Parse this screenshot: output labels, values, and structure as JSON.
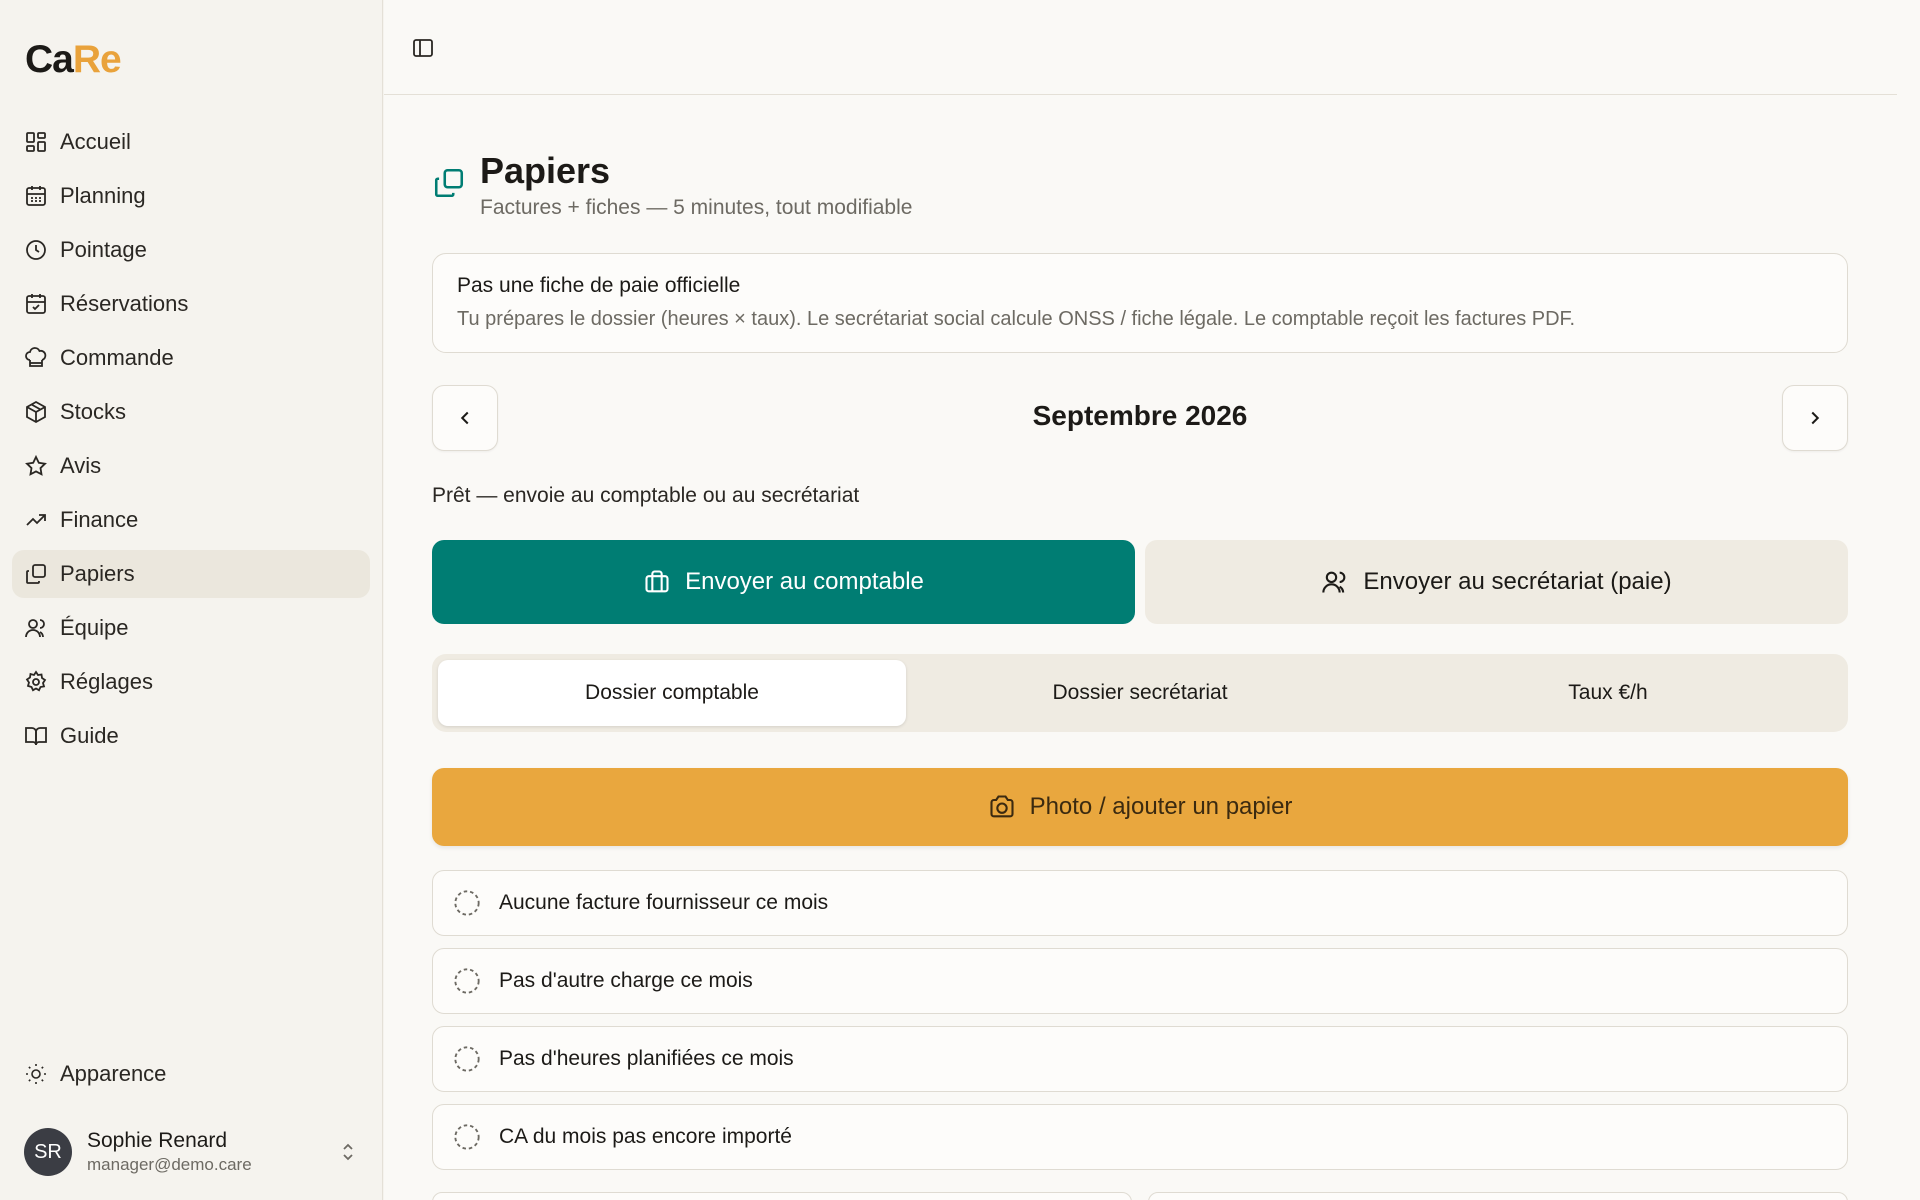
{
  "logo": {
    "part1": "Ca",
    "part2": "Re"
  },
  "colors": {
    "primary": "#007d73",
    "accent": "#e9a73e",
    "active_nav": "#ebe7dd"
  },
  "sidebar": {
    "items": [
      {
        "label": "Accueil",
        "icon": "dashboard-icon"
      },
      {
        "label": "Planning",
        "icon": "calendar-icon"
      },
      {
        "label": "Pointage",
        "icon": "clock-icon"
      },
      {
        "label": "Réservations",
        "icon": "calendar-check-icon"
      },
      {
        "label": "Commande",
        "icon": "chef-hat-icon"
      },
      {
        "label": "Stocks",
        "icon": "package-icon"
      },
      {
        "label": "Avis",
        "icon": "star-icon"
      },
      {
        "label": "Finance",
        "icon": "trending-up-icon"
      },
      {
        "label": "Papiers",
        "icon": "copy-icon",
        "active": true
      },
      {
        "label": "Équipe",
        "icon": "users-icon"
      },
      {
        "label": "Réglages",
        "icon": "gear-icon"
      },
      {
        "label": "Guide",
        "icon": "book-icon"
      }
    ],
    "appearance": "Apparence",
    "user": {
      "initials": "SR",
      "name": "Sophie Renard",
      "email": "manager@demo.care"
    }
  },
  "page": {
    "title": "Papiers",
    "subtitle": "Factures + fiches — 5 minutes, tout modifiable"
  },
  "notice": {
    "title": "Pas une fiche de paie officielle",
    "text": "Tu prépares le dossier (heures × taux). Le secrétariat social calcule ONSS / fiche légale. Le comptable reçoit les factures PDF."
  },
  "month": {
    "label": "Septembre 2026"
  },
  "status": "Prêt — envoie au comptable ou au secrétariat",
  "actions": {
    "send_accountant": "Envoyer au comptable",
    "send_secretariat": "Envoyer au secrétariat (paie)"
  },
  "tabs": [
    {
      "label": "Dossier comptable",
      "active": true
    },
    {
      "label": "Dossier secrétariat"
    },
    {
      "label": "Taux €/h"
    }
  ],
  "photo_button": "Photo / ajouter un papier",
  "checklist": [
    "Aucune facture fournisseur ce mois",
    "Pas d'autre charge ce mois",
    "Pas d'heures planifiées ce mois",
    "CA du mois pas encore importé"
  ]
}
